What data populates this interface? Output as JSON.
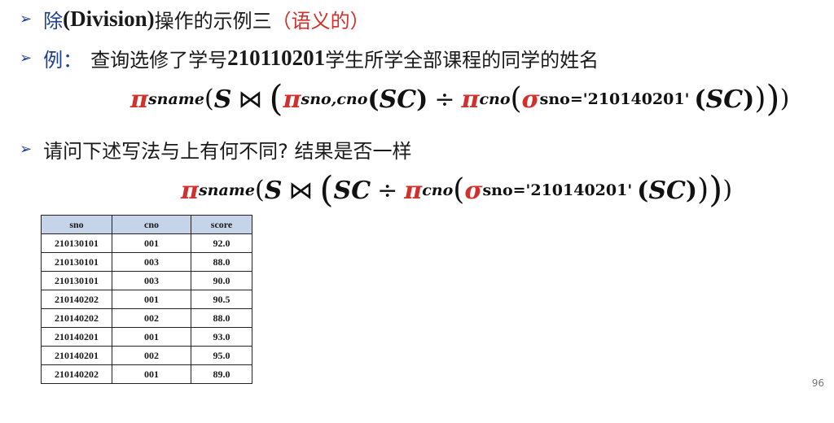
{
  "bullets": [
    {
      "prefix": "除",
      "bold": "(Division)",
      "rest": "操作的示例三",
      "note": "（语义的）"
    },
    {
      "prefix": "例：",
      "rest_a": "查询选修了学号",
      "bold": "210110201",
      "rest_b": "学生所学全部课程的同学的姓名"
    },
    {
      "text": "请问下述写法与上有何不同? 结果是否一样"
    }
  ],
  "formula1": {
    "pi": "π",
    "sub_sname": "sname",
    "s": "S",
    "join": "⋈",
    "sub_snocno": "sno,cno",
    "sc": "SC",
    "div": "÷",
    "sub_cno": "cno",
    "sigma": "σ",
    "sub_cond": "sno='210140201'"
  },
  "formula2": {
    "pi": "π",
    "sub_sname": "sname",
    "s": "S",
    "join": "⋈",
    "sc": "SC",
    "div": "÷",
    "sub_cno": "cno",
    "sigma": "σ",
    "sub_cond": "sno='210140201'"
  },
  "table": {
    "headers": [
      "sno",
      "cno",
      "score"
    ],
    "rows": [
      [
        "210130101",
        "001",
        "92.0"
      ],
      [
        "210130101",
        "003",
        "88.0"
      ],
      [
        "210130101",
        "003",
        "90.0"
      ],
      [
        "210140202",
        "001",
        "90.5"
      ],
      [
        "210140202",
        "002",
        "88.0"
      ],
      [
        "210140201",
        "001",
        "93.0"
      ],
      [
        "210140201",
        "002",
        "95.0"
      ],
      [
        "210140202",
        "001",
        "89.0"
      ]
    ]
  },
  "page_number": "96",
  "colors": {
    "accent_blue": "#1f3f8f",
    "accent_red": "#d0312d",
    "header_fill": "#c6d4ea"
  }
}
